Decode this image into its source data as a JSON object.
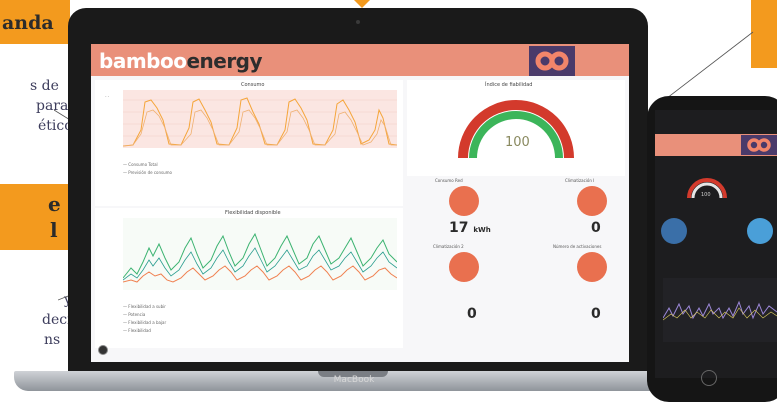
{
  "left_callout_1": {
    "title": "anda"
  },
  "left_text_1": {
    "lines": [
      "s de",
      "para",
      "ético"
    ]
  },
  "left_callout_2": {
    "line1": "e",
    "line2": "l"
  },
  "left_text_2": {
    "lines": [
      "y",
      "decir",
      "ns"
    ]
  },
  "laptop": {
    "brand_white": "bamboo",
    "brand_dark": "energy",
    "label": "MacBook"
  },
  "panels": {
    "consumo": {
      "title": "Consumo"
    },
    "flexibilidad": {
      "title": "Flexibilidad disponible"
    },
    "indice": {
      "title": "Índice de fiabilidad"
    },
    "consumo_red": {
      "title": "Consumo Red"
    },
    "climatizacion1": {
      "title": "Climatización I"
    },
    "climatizacion2": {
      "title": "Climatización 2"
    },
    "activaciones": {
      "title": "Número de activaciones"
    }
  },
  "gauge": {
    "value": "100"
  },
  "metrics": {
    "consumo_red_value": "17",
    "consumo_red_unit": "kWh",
    "climatizacion1_value": "0",
    "climatizacion2_value": "0",
    "activaciones_value": "0"
  },
  "consumo_legend": [
    "Consumo Total",
    "Previsión de consumo"
  ],
  "flex_legend": [
    "Flexibilidad a subir",
    "Potencia",
    "Flexibilidad a bajar",
    "Flexibilidad"
  ],
  "phone": {
    "gauge_value": "100"
  },
  "colors": {
    "accent_orange": "#f39a1e",
    "header_salmon": "#e9907a",
    "line_orange": "#f5a53a",
    "line_green": "#3cb371",
    "icon_coral": "#e9704f"
  }
}
